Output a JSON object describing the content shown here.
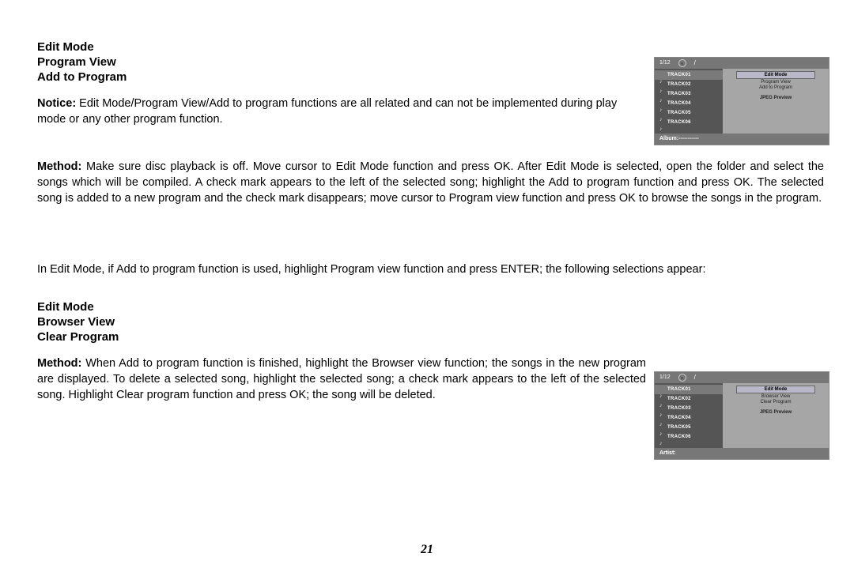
{
  "section1": {
    "h1": "Edit Mode",
    "h2": "Program View",
    "h3": "Add to Program",
    "notice_label": "Notice:",
    "notice_text": " Edit Mode/Program View/Add to program functions are all related and can not be implemented during play mode or any other program function.",
    "method_label": "Method:",
    "method_text": " Make sure disc playback is off. Move cursor to Edit Mode function and press OK. After Edit Mode is selected, open the folder and select the songs which will be compiled. A check mark appears to the left of the selected song; highlight the  Add to program function and press OK. The selected song is added to a new program and the check mark disappears; move cursor to Program view  function and press OK to browse the songs in the program."
  },
  "mid_para": "In Edit Mode, if Add to program function is used, highlight Program view function and press ENTER; the following selections appear:",
  "section2": {
    "h1": "Edit Mode",
    "h2": "Browser View",
    "h3": "Clear Program",
    "method_label": "Method:",
    "method_text": " When Add to program function is finished, highlight the Browser view function; the songs in the new program are displayed. To delete a selected song, highlight the selected song; a check mark appears to the left of the selected song. Highlight  Clear program function and press OK; the song will be deleted."
  },
  "page_number": "21",
  "mini1": {
    "counter": "1/12",
    "tracks": [
      "TRACK01",
      "TRACK02",
      "TRACK03",
      "TRACK04",
      "TRACK05",
      "TRACK06"
    ],
    "menu_top": "Edit  Mode",
    "menu_a": "Program View",
    "menu_b": "Add to Program",
    "jpeg": "JPEG Preview",
    "footer": "Album:-----------"
  },
  "mini2": {
    "counter": "1/12",
    "tracks": [
      "TRACK01",
      "TRACK02",
      "TRACK03",
      "TRACK04",
      "TRACK05",
      "TRACK06"
    ],
    "menu_top": "Edit  Mode",
    "menu_a": "Browser View",
    "menu_b": "Clear Program",
    "jpeg": "JPEG Preview",
    "footer": "Artist:"
  }
}
